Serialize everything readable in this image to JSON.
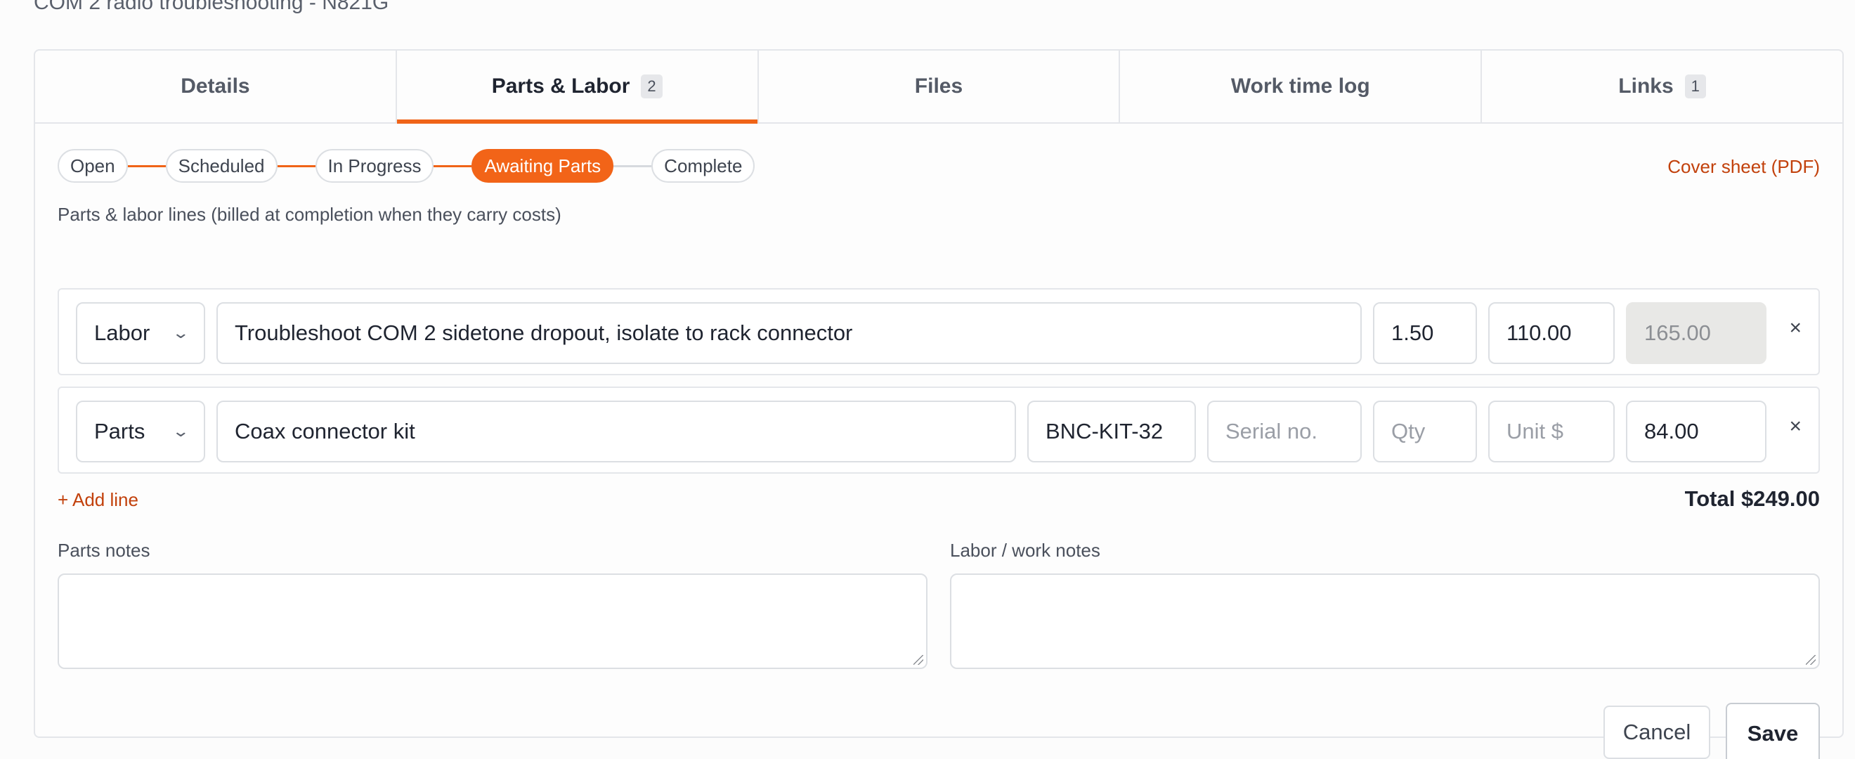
{
  "page": {
    "title": "COM 2 radio troubleshooting - N821G"
  },
  "tabs": [
    {
      "label": "Details",
      "count": null
    },
    {
      "label": "Parts & Labor",
      "count": "2"
    },
    {
      "label": "Files",
      "count": null
    },
    {
      "label": "Work time log",
      "count": null
    },
    {
      "label": "Links",
      "count": "1"
    }
  ],
  "active_tab": "Parts & Labor",
  "status_steps": [
    "Open",
    "Scheduled",
    "In Progress",
    "Awaiting Parts",
    "Complete"
  ],
  "current_status": "Awaiting Parts",
  "cover_sheet_label": "Cover sheet (PDF)",
  "section_label": "Parts & labor lines (billed at completion when they carry costs)",
  "lines": [
    {
      "type": "Labor",
      "description": "Troubleshoot COM 2 sidetone dropout, isolate to rack connector",
      "hours": "1.50",
      "rate": "110.00",
      "amount": "165.00"
    },
    {
      "type": "Parts",
      "description": "Coax connector kit",
      "part_number": "BNC-KIT-32",
      "serial_placeholder": "Serial no.",
      "qty_placeholder": "Qty",
      "unit_placeholder": "Unit $",
      "amount": "84.00"
    }
  ],
  "remove_glyph": "×",
  "add_line_label": "+ Add line",
  "total_label": "Total $249.00",
  "parts_notes_label": "Parts notes",
  "labor_notes_label": "Labor / work notes",
  "cancel_label": "Cancel",
  "save_label": "Save",
  "colors": {
    "accent": "#f26418",
    "link": "#c2410c"
  }
}
